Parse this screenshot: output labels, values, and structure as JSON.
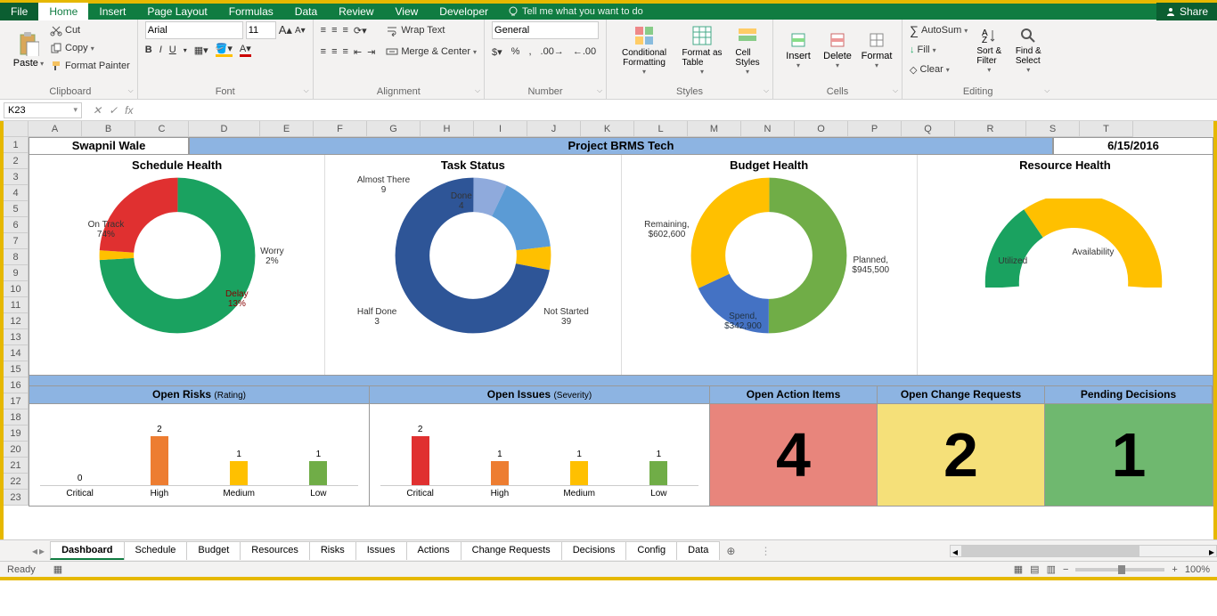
{
  "ribbon": {
    "tabs": [
      "File",
      "Home",
      "Insert",
      "Page Layout",
      "Formulas",
      "Data",
      "Review",
      "View",
      "Developer"
    ],
    "active_tab": "Home",
    "tell_me": "Tell me what you want to do",
    "share": "Share",
    "clipboard": {
      "paste": "Paste",
      "cut": "Cut",
      "copy": "Copy",
      "painter": "Format Painter",
      "label": "Clipboard"
    },
    "font": {
      "name": "Arial",
      "size": "11",
      "label": "Font"
    },
    "alignment": {
      "wrap": "Wrap Text",
      "merge": "Merge & Center",
      "label": "Alignment"
    },
    "number": {
      "format": "General",
      "label": "Number"
    },
    "styles": {
      "cond": "Conditional Formatting",
      "table": "Format as Table",
      "cell": "Cell Styles",
      "label": "Styles"
    },
    "cells": {
      "insert": "Insert",
      "delete": "Delete",
      "format": "Format",
      "label": "Cells"
    },
    "editing": {
      "sum": "AutoSum",
      "fill": "Fill",
      "clear": "Clear",
      "sort": "Sort & Filter",
      "find": "Find & Select",
      "label": "Editing"
    }
  },
  "formula_bar": {
    "name_box": "K23",
    "formula": ""
  },
  "columns": [
    "A",
    "B",
    "C",
    "D",
    "E",
    "F",
    "G",
    "H",
    "I",
    "J",
    "K",
    "L",
    "M",
    "N",
    "O",
    "P",
    "Q",
    "R",
    "S",
    "T"
  ],
  "rows": [
    "1",
    "2",
    "3",
    "4",
    "5",
    "6",
    "7",
    "8",
    "9",
    "10",
    "11",
    "12",
    "13",
    "14",
    "15",
    "16",
    "17",
    "18",
    "19",
    "20",
    "21",
    "22",
    "23"
  ],
  "dashboard": {
    "author": "Swapnil Wale",
    "title": "Project BRMS Tech",
    "date": "6/15/2016",
    "charts": {
      "schedule": {
        "title": "Schedule Health",
        "labels": {
          "ontrack": "On Track\n74%",
          "worry": "Worry\n2%",
          "delay": "Delay\n13%"
        }
      },
      "task": {
        "title": "Task Status",
        "labels": {
          "done": "Done\n4",
          "almost": "Almost There\n9",
          "half": "Half Done\n3",
          "notstarted": "Not Started\n39"
        }
      },
      "budget": {
        "title": "Budget Health",
        "labels": {
          "planned": "Planned,\n$945,500",
          "spend": "Spend,\n$342,900",
          "remaining": "Remaining,\n$602,600"
        }
      },
      "resource": {
        "title": "Resource Health",
        "labels": {
          "avail": "Availability",
          "util": "Utilized"
        }
      }
    },
    "metrics_headers": {
      "risks": "Open Risks",
      "risks_sub": "(Rating)",
      "issues": "Open Issues",
      "issues_sub": "(Severity)",
      "actions": "Open Action Items",
      "changes": "Open Change Requests",
      "decisions": "Pending Decisions"
    },
    "risk_categories": [
      "Critical",
      "High",
      "Medium",
      "Low"
    ],
    "big_metrics": {
      "actions": "4",
      "changes": "2",
      "decisions": "1"
    }
  },
  "chart_data": [
    {
      "type": "pie",
      "title": "Schedule Health",
      "series": [
        {
          "name": "On Track",
          "value": 74
        },
        {
          "name": "Worry",
          "value": 2
        },
        {
          "name": "Delay",
          "value": 13
        }
      ]
    },
    {
      "type": "pie",
      "title": "Task Status",
      "series": [
        {
          "name": "Done",
          "value": 4
        },
        {
          "name": "Almost There",
          "value": 9
        },
        {
          "name": "Half Done",
          "value": 3
        },
        {
          "name": "Not Started",
          "value": 39
        }
      ]
    },
    {
      "type": "pie",
      "title": "Budget Health",
      "series": [
        {
          "name": "Planned",
          "value": 945500
        },
        {
          "name": "Spend",
          "value": 342900
        },
        {
          "name": "Remaining",
          "value": 602600
        }
      ]
    },
    {
      "type": "pie",
      "title": "Resource Health",
      "series": [
        {
          "name": "Availability",
          "value": 80
        },
        {
          "name": "Utilized",
          "value": 20
        }
      ]
    },
    {
      "type": "bar",
      "title": "Open Risks (Rating)",
      "categories": [
        "Critical",
        "High",
        "Medium",
        "Low"
      ],
      "values": [
        0,
        2,
        1,
        1
      ],
      "ylim": [
        0,
        2
      ]
    },
    {
      "type": "bar",
      "title": "Open Issues (Severity)",
      "categories": [
        "Critical",
        "High",
        "Medium",
        "Low"
      ],
      "values": [
        2,
        1,
        1,
        1
      ],
      "ylim": [
        0,
        2
      ]
    }
  ],
  "sheet_tabs": [
    "Dashboard",
    "Schedule",
    "Budget",
    "Resources",
    "Risks",
    "Issues",
    "Actions",
    "Change Requests",
    "Decisions",
    "Config",
    "Data"
  ],
  "active_sheet": "Dashboard",
  "status": {
    "ready": "Ready",
    "zoom": "100%"
  }
}
